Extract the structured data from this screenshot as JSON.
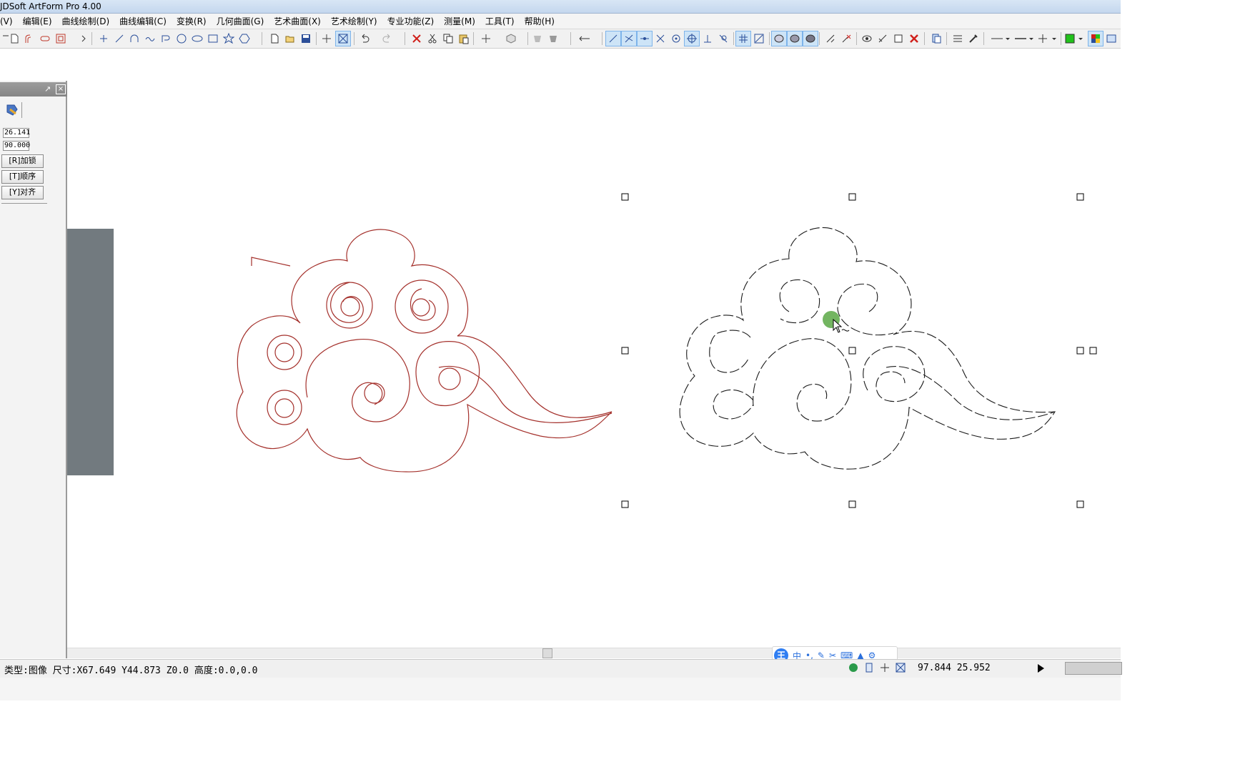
{
  "app": {
    "title": "JDSoft ArtForm Pro 4.00"
  },
  "menu": [
    "(V)",
    "编辑(E)",
    "曲线绘制(D)",
    "曲线编辑(C)",
    "变换(R)",
    "几何曲面(G)",
    "艺术曲面(X)",
    "艺术绘制(Y)",
    "专业功能(Z)",
    "测量(M)",
    "工具(T)",
    "帮助(H)"
  ],
  "panel": {
    "field1": "26.141",
    "field2": "90.000",
    "btn_lock": "[R]加锁",
    "btn_order": "[T]顺序",
    "btn_align": "[Y]对齐"
  },
  "ime": {
    "logo": "王",
    "mode": "中",
    "punct": "•,"
  },
  "status": {
    "info": "类型:图像 尺寸:X67.649 Y44.873 Z0.0 高度:0.0,0.0",
    "coords": "97.844 25.952"
  },
  "colors": {
    "curve_red": "#a4302b",
    "selection_handle": "#000000",
    "cursor_highlight": "#5aa845"
  }
}
